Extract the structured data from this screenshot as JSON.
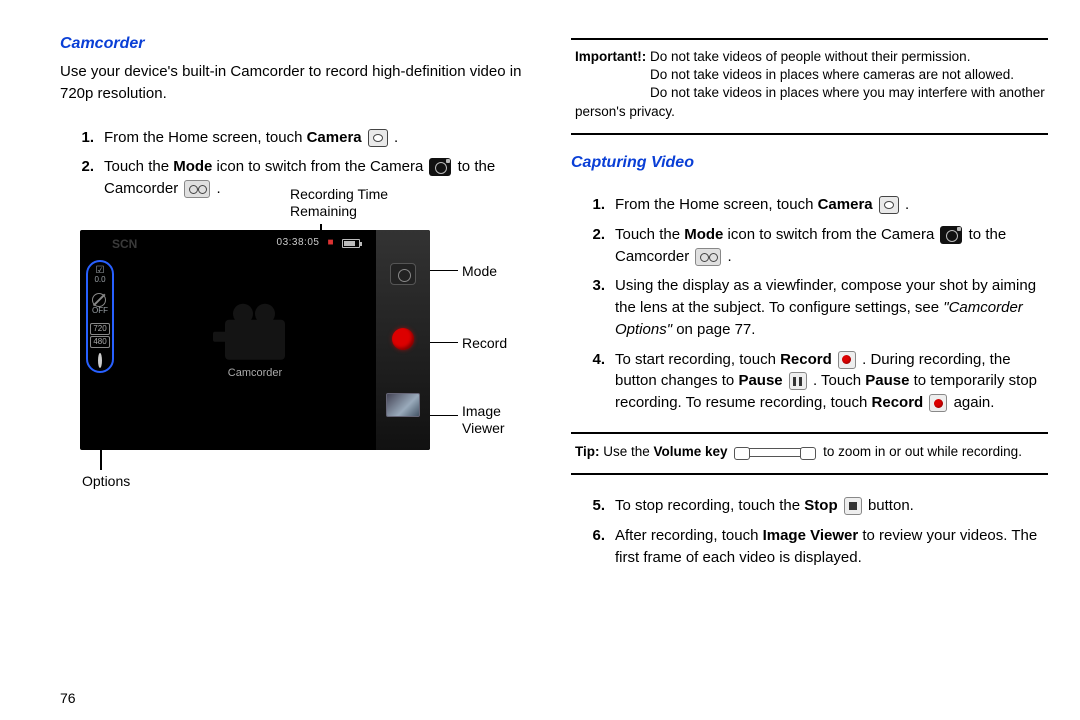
{
  "left": {
    "heading": "Camcorder",
    "intro": "Use your device's built-in Camcorder to record high-definition video in 720p resolution.",
    "steps": [
      {
        "num": "1.",
        "pre": "From the Home screen, touch ",
        "bold": "Camera",
        "post": " ."
      },
      {
        "num": "2.",
        "pre": "Touch the ",
        "bold": "Mode",
        "mid": " icon to switch from the Camera ",
        "mid2": " to the Camcorder ",
        "post": " ."
      }
    ],
    "shot": {
      "scn": "SCN",
      "timecode": "03:38:05",
      "center_label": "Camcorder",
      "left_opts_ev_top": "☑",
      "left_opts_ev_bot": "0.0",
      "left_opts_res_top": "720",
      "left_opts_res_bot": "480"
    },
    "callouts": {
      "rec_time_l1": "Recording Time",
      "rec_time_l2": "Remaining",
      "mode": "Mode",
      "record": "Record",
      "image_l1": "Image",
      "image_l2": "Viewer",
      "options": "Options"
    }
  },
  "right": {
    "important_label": "Important!:",
    "important_lines": [
      "Do not take videos of people without their permission.",
      "Do not take videos in places where cameras are not allowed.",
      "Do not take videos in places where you may interfere with another person's privacy."
    ],
    "heading": "Capturing Video",
    "steps": {
      "s1": {
        "num": "1.",
        "pre": "From the Home screen, touch ",
        "bold": "Camera",
        "post": " ."
      },
      "s2": {
        "num": "2.",
        "pre": "Touch the ",
        "bold": "Mode",
        "mid": " icon to switch from the Camera ",
        "mid2": " to the Camcorder ",
        "post": " ."
      },
      "s3": {
        "num": "3.",
        "txt1": "Using the display as a viewfinder, compose your shot by aiming the lens at the subject. To configure settings, see ",
        "ital": "\"Camcorder Options\"",
        "txt2": " on page 77."
      },
      "s4": {
        "num": "4.",
        "a": "To start recording, touch ",
        "rec": "Record",
        "b": " . During recording, the button changes to ",
        "pause": "Pause",
        "c": " . Touch ",
        "pause2": "Pause",
        "d": " to temporarily stop recording. To resume recording, touch ",
        "rec2": "Record",
        "e": " again."
      },
      "s5": {
        "num": "5.",
        "a": "To stop recording, touch the ",
        "stop": "Stop",
        "b": " button."
      },
      "s6": {
        "num": "6.",
        "a": "After recording, touch ",
        "iv": "Image Viewer",
        "b": " to review your videos. The first frame of each video is displayed."
      }
    },
    "tip_label": "Tip:",
    "tip_a": " Use the ",
    "tip_b": "Volume key",
    "tip_c": " to zoom in or out while recording."
  },
  "page_number": "76"
}
